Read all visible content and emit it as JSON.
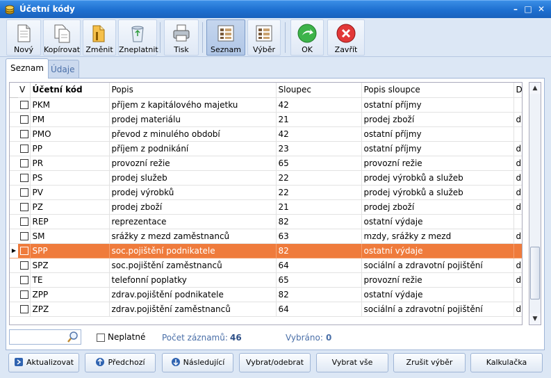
{
  "window": {
    "title": "Účetní kódy"
  },
  "toolbar": {
    "buttons": [
      {
        "label": "Nový"
      },
      {
        "label": "Kopírovat"
      },
      {
        "label": "Změnit"
      },
      {
        "label": "Zneplatnit"
      },
      {
        "label": "Tisk"
      },
      {
        "label": "Seznam"
      },
      {
        "label": "Výběr"
      },
      {
        "label": "OK"
      },
      {
        "label": "Zavřít"
      }
    ]
  },
  "tabs": [
    {
      "label": "Seznam"
    },
    {
      "label": "Údaje"
    }
  ],
  "grid": {
    "columns": [
      "V",
      "Účetní kód",
      "Popis",
      "Sloupec",
      "Popis sloupce",
      "D"
    ],
    "rows": [
      {
        "code": "PKM",
        "popis": "příjem z kapitálového majetku",
        "sloupec": "42",
        "popis_sloupce": "ostatní příjmy",
        "d": ""
      },
      {
        "code": "PM",
        "popis": "prodej materiálu",
        "sloupec": "21",
        "popis_sloupce": "prodej zboží",
        "d": "d"
      },
      {
        "code": "PMO",
        "popis": "převod z minulého období",
        "sloupec": "42",
        "popis_sloupce": "ostatní příjmy",
        "d": ""
      },
      {
        "code": "PP",
        "popis": "příjem z podnikání",
        "sloupec": "23",
        "popis_sloupce": "ostatní příjmy",
        "d": "d"
      },
      {
        "code": "PR",
        "popis": "provozní režie",
        "sloupec": "65",
        "popis_sloupce": "provozní režie",
        "d": "d"
      },
      {
        "code": "PS",
        "popis": "prodej služeb",
        "sloupec": "22",
        "popis_sloupce": "prodej výrobků a služeb",
        "d": "d"
      },
      {
        "code": "PV",
        "popis": "prodej výrobků",
        "sloupec": "22",
        "popis_sloupce": "prodej výrobků a služeb",
        "d": "d"
      },
      {
        "code": "PZ",
        "popis": "prodej zboží",
        "sloupec": "21",
        "popis_sloupce": "prodej zboží",
        "d": "d"
      },
      {
        "code": "REP",
        "popis": "reprezentace",
        "sloupec": "82",
        "popis_sloupce": "ostatní výdaje",
        "d": ""
      },
      {
        "code": "SM",
        "popis": "srážky z mezd zaměstnanců",
        "sloupec": "63",
        "popis_sloupce": "mzdy, srážky z mezd",
        "d": "d"
      },
      {
        "code": "SPP",
        "popis": "soc.pojištění podnikatele",
        "sloupec": "82",
        "popis_sloupce": "ostatní výdaje",
        "d": "",
        "selected": true
      },
      {
        "code": "SPZ",
        "popis": "soc.pojištění zaměstnanců",
        "sloupec": "64",
        "popis_sloupce": "sociální a zdravotní pojištění",
        "d": "d"
      },
      {
        "code": "TE",
        "popis": "telefonní poplatky",
        "sloupec": "65",
        "popis_sloupce": "provozní režie",
        "d": "d"
      },
      {
        "code": "ZPP",
        "popis": "zdrav.pojištění podnikatele",
        "sloupec": "82",
        "popis_sloupce": "ostatní výdaje",
        "d": ""
      },
      {
        "code": "ZPZ",
        "popis": "zdrav.pojištění zaměstnanců",
        "sloupec": "64",
        "popis_sloupce": "sociální a zdravotní pojištění",
        "d": "d"
      }
    ]
  },
  "filter": {
    "search_value": "",
    "neplatne_label": "Neplatné",
    "count_label": "Počet záznamů:",
    "count_value": "46",
    "selected_label": "Vybráno:",
    "selected_value": "0"
  },
  "bottom_buttons": [
    {
      "label": "Aktualizovat"
    },
    {
      "label": "Předchozí"
    },
    {
      "label": "Následující"
    },
    {
      "label": "Vybrat/odebrat"
    },
    {
      "label": "Vybrat vše"
    },
    {
      "label": "Zrušit výběr"
    },
    {
      "label": "Kalkulačka"
    }
  ],
  "colors": {
    "selected_row": "#ef7b3c",
    "titlebar": "#1e6fd0",
    "accent_text": "#4a6fa8"
  }
}
